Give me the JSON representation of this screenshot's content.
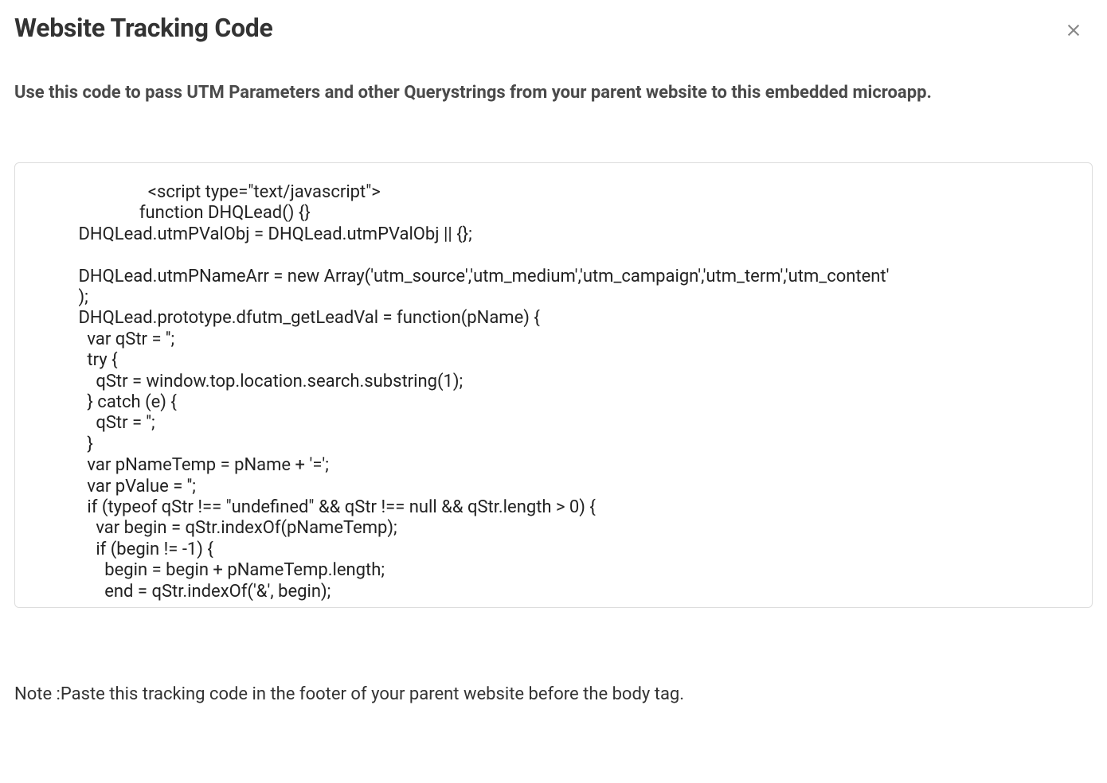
{
  "modal": {
    "title": "Website Tracking Code",
    "subtitle": "Use this code to pass UTM Parameters and other Querystrings from your parent website to this embedded microapp.",
    "code": "                            <script type=\"text/javascript\">\n                          function DHQLead() {}\n            DHQLead.utmPValObj = DHQLead.utmPValObj || {};\n\n            DHQLead.utmPNameArr = new Array('utm_source','utm_medium','utm_campaign','utm_term','utm_content'\n            );\n            DHQLead.prototype.dfutm_getLeadVal = function(pName) {\n              var qStr = '';\n              try {\n                qStr = window.top.location.search.substring(1);\n              } catch (e) {\n                qStr = '';\n              }\n              var pNameTemp = pName + '=';\n              var pValue = '';\n              if (typeof qStr !== \"undefined\" && qStr !== null && qStr.length > 0) {\n                var begin = qStr.indexOf(pNameTemp);\n                if (begin != -1) {\n                  begin = begin + pNameTemp.length;\n                  end = qStr.indexOf('&', begin);",
    "note": "Note :Paste this tracking code in the footer of your parent website before the body tag."
  }
}
